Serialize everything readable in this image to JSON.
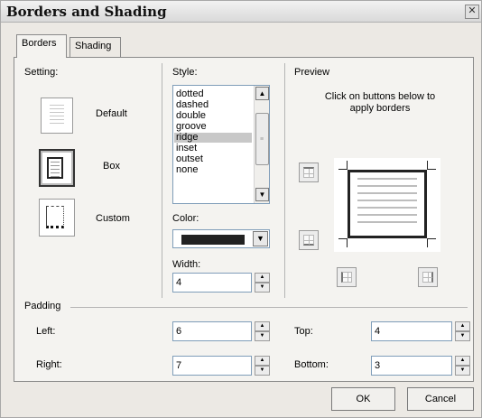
{
  "dialog": {
    "title": "Borders and Shading",
    "close_glyph": "✕"
  },
  "tabs": [
    {
      "label": "Borders"
    },
    {
      "label": "Shading"
    }
  ],
  "setting": {
    "section_label": "Setting:",
    "options": [
      {
        "label": "Default"
      },
      {
        "label": "Box"
      },
      {
        "label": "Custom"
      }
    ],
    "selected": "Box"
  },
  "style": {
    "section_label": "Style:",
    "items": [
      "dotted",
      "dashed",
      "double",
      "groove",
      "ridge",
      "inset",
      "outset",
      "none"
    ],
    "selected": "ridge",
    "scroll_up": "▲",
    "scroll_down": "▼",
    "grip": "≡"
  },
  "color": {
    "label": "Color:",
    "value": "#222222",
    "dropdown_glyph": "▼"
  },
  "width": {
    "label": "Width:",
    "value": "4"
  },
  "spinner": {
    "up": "▲",
    "down": "▼"
  },
  "preview": {
    "section_label": "Preview",
    "hint": "Click on buttons below to apply borders"
  },
  "padding": {
    "section_label": "Padding",
    "left": {
      "label": "Left:",
      "value": "6"
    },
    "right": {
      "label": "Right:",
      "value": "7"
    },
    "top": {
      "label": "Top:",
      "value": "4"
    },
    "bottom": {
      "label": "Bottom:",
      "value": "3"
    }
  },
  "buttons": {
    "ok": "OK",
    "cancel": "Cancel"
  }
}
